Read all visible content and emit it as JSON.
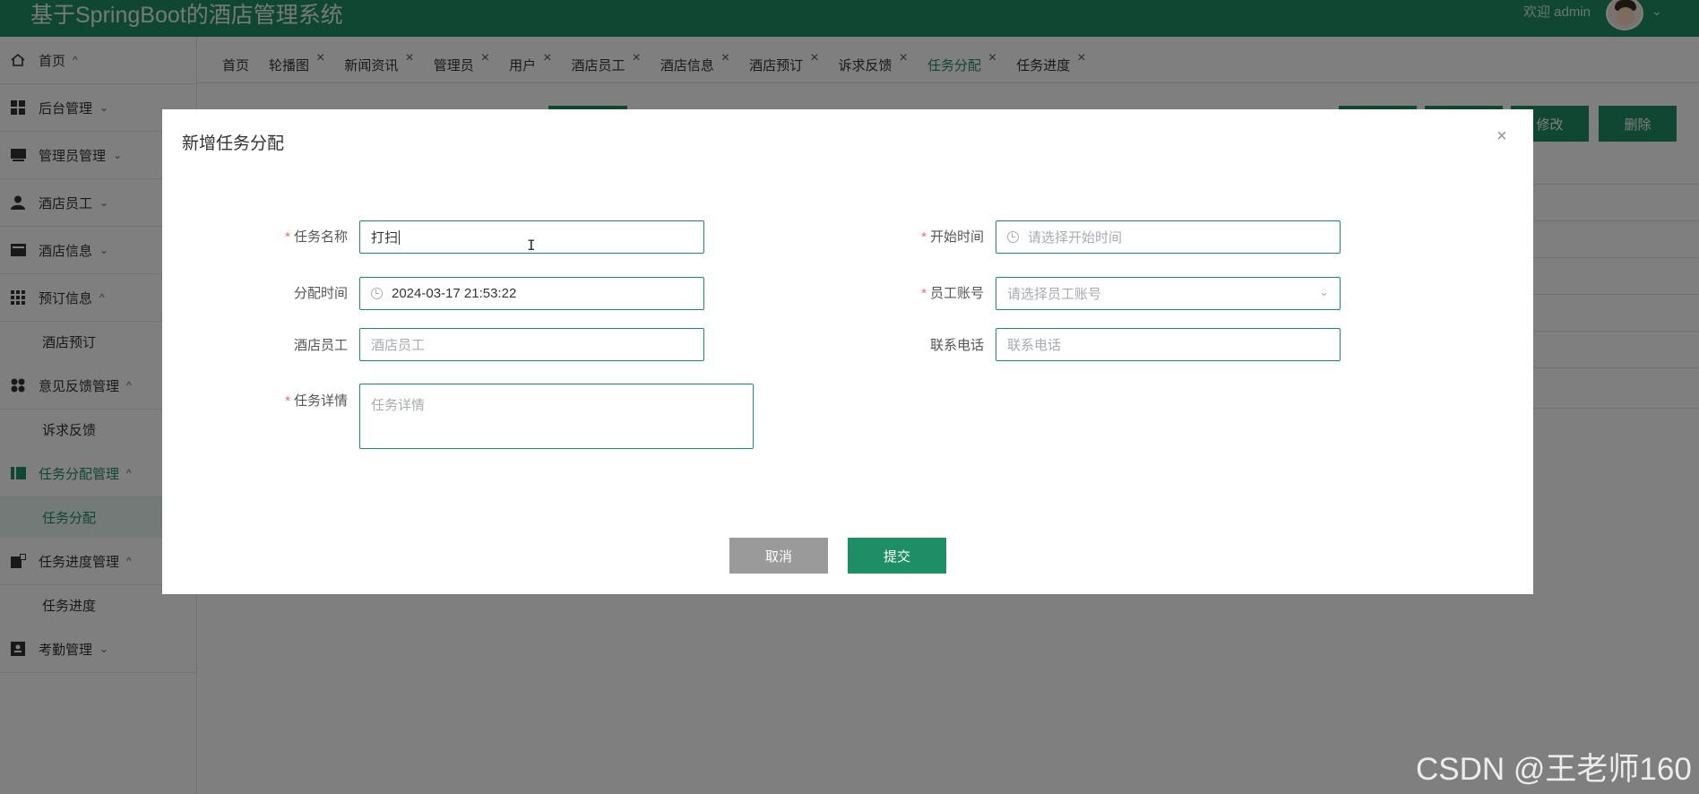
{
  "header": {
    "title": "基于SpringBoot的酒店管理系统",
    "welcome": "欢迎 admin"
  },
  "sidebar": {
    "items": [
      {
        "label": "首页",
        "icon": "home-icon",
        "arrow": "^"
      },
      {
        "label": "后台管理",
        "icon": "grid-icon",
        "arrow": "v"
      },
      {
        "label": "管理员管理",
        "icon": "monitor-icon",
        "arrow": "v"
      },
      {
        "label": "酒店员工",
        "icon": "user-icon",
        "arrow": "v"
      },
      {
        "label": "酒店信息",
        "icon": "card-icon",
        "arrow": "v"
      },
      {
        "label": "预订信息",
        "icon": "apps-icon",
        "arrow": "^"
      },
      {
        "label": "意见反馈管理",
        "icon": "dots-icon",
        "arrow": "^"
      },
      {
        "label": "任务分配管理",
        "icon": "book-icon",
        "arrow": "^"
      },
      {
        "label": "任务进度管理",
        "icon": "progress-icon",
        "arrow": "^"
      },
      {
        "label": "考勤管理",
        "icon": "badge-icon",
        "arrow": "v"
      }
    ],
    "subitems": {
      "booking": "酒店预订",
      "feedback": "诉求反馈",
      "task": "任务分配",
      "progress": "任务进度"
    }
  },
  "tabs": [
    {
      "label": "首页",
      "closable": false
    },
    {
      "label": "轮播图",
      "closable": true
    },
    {
      "label": "新闻资讯",
      "closable": true
    },
    {
      "label": "管理员",
      "closable": true
    },
    {
      "label": "用户",
      "closable": true
    },
    {
      "label": "酒店员工",
      "closable": true
    },
    {
      "label": "酒店信息",
      "closable": true
    },
    {
      "label": "酒店预订",
      "closable": true
    },
    {
      "label": "诉求反馈",
      "closable": true
    },
    {
      "label": "任务分配",
      "closable": true,
      "active": true
    },
    {
      "label": "任务进度",
      "closable": true
    }
  ],
  "background": {
    "edit_label": "修改",
    "delete_label": "删除"
  },
  "dialog": {
    "title": "新增任务分配",
    "close": "×",
    "fields": {
      "task_name": {
        "label": "任务名称",
        "value": "打扫"
      },
      "start_time": {
        "label": "开始时间",
        "placeholder": "请选择开始时间"
      },
      "assign_time": {
        "label": "分配时间",
        "value": "2024-03-17 21:53:22"
      },
      "staff_account": {
        "label": "员工账号",
        "placeholder": "请选择员工账号"
      },
      "staff": {
        "label": "酒店员工",
        "placeholder": "酒店员工"
      },
      "phone": {
        "label": "联系电话",
        "placeholder": "联系电话"
      },
      "details": {
        "label": "任务详情",
        "placeholder": "任务详情"
      }
    },
    "cancel_label": "取消",
    "submit_label": "提交"
  },
  "watermark": "CSDN @王老师160",
  "colors": {
    "primary": "#1e8e66",
    "required": "#f56c6c",
    "cancel": "#9a9a9a"
  }
}
